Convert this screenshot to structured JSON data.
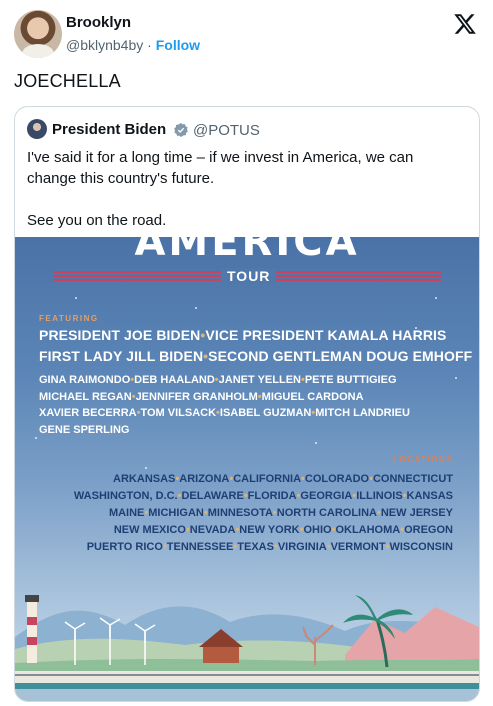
{
  "author": {
    "name": "Brooklyn",
    "handle": "@bklynb4by",
    "separator": "·",
    "follow_label": "Follow"
  },
  "tweet_text": "JOECHELLA",
  "quote": {
    "name": "President Biden",
    "handle": "@POTUS",
    "text": "I've said it for a long time – if we invest in America, we can change this country's future.\n\nSee you on the road.",
    "poster": {
      "title": "AMERICA",
      "tour": "TOUR",
      "featuring": "FEATURING",
      "featured_big": [
        [
          "PRESIDENT JOE BIDEN",
          "VICE PRESIDENT KAMALA HARRIS"
        ],
        [
          "FIRST LADY JILL BIDEN",
          "SECOND GENTLEMAN DOUG EMHOFF"
        ]
      ],
      "featured_small": [
        [
          "GINA RAIMONDO",
          "DEB HAALAND",
          "JANET YELLEN",
          "PETE BUTTIGIEG"
        ],
        [
          "MICHAEL REGAN",
          "JENNIFER GRANHOLM",
          "MIGUEL CARDONA"
        ],
        [
          "XAVIER BECERRA",
          "TOM VILSACK",
          "ISABEL GUZMAN",
          "MITCH LANDRIEU"
        ],
        [
          "GENE SPERLING"
        ]
      ],
      "locations_label": "LOCATIONS",
      "locations": [
        [
          "ARKANSAS",
          "ARIZONA",
          "CALIFORNIA",
          "COLORADO",
          "CONNECTICUT"
        ],
        [
          "WASHINGTON, D.C.",
          "DELAWARE",
          "FLORIDA",
          "GEORGIA",
          "ILLINOIS",
          "KANSAS"
        ],
        [
          "MAINE",
          "MICHIGAN",
          "MINNESOTA",
          "NORTH CAROLINA",
          "NEW JERSEY"
        ],
        [
          "NEW MEXICO",
          "NEVADA",
          "NEW YORK",
          "OHIO",
          "OKLAHOMA",
          "OREGON"
        ],
        [
          "PUERTO RICO",
          "TENNESSEE",
          "TEXAS",
          "VIRGINIA",
          "VERMONT",
          "WISCONSIN"
        ]
      ],
      "separator": "•"
    }
  },
  "icons": {
    "logo": "x-logo-icon",
    "verified": "verified-badge-icon"
  },
  "colors": {
    "link": "#1d9bf0",
    "muted": "#536471",
    "border": "#cfd9de",
    "stripe": "#c8435d",
    "states": "#1f3f74"
  }
}
